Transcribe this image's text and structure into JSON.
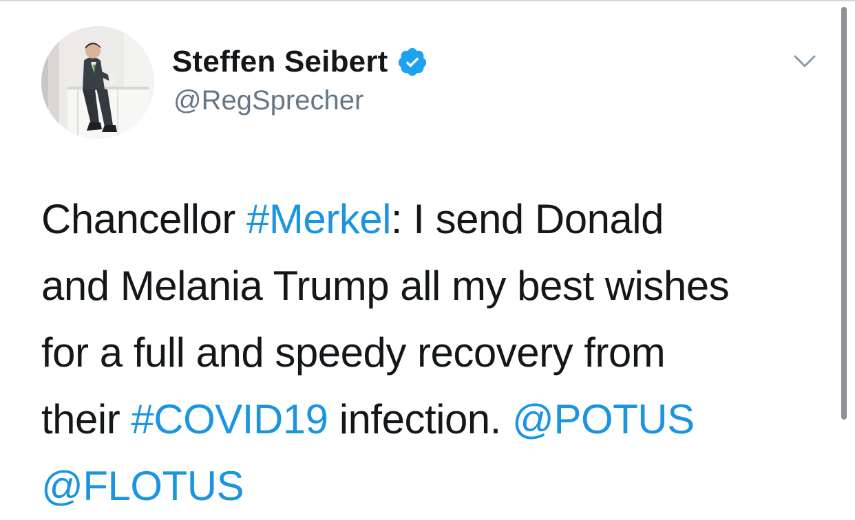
{
  "tweet": {
    "author": {
      "display_name": "Steffen Seibert",
      "handle": "@RegSprecher",
      "verified": true,
      "avatar_icon": "person-photo"
    },
    "more_icon": "chevron-down-icon",
    "text_lines": [
      [
        {
          "text": "Chancellor ",
          "type": "text"
        },
        {
          "text": "#Merkel",
          "type": "hashtag"
        },
        {
          "text": ": I send Donald",
          "type": "text"
        }
      ],
      [
        {
          "text": "and Melania Trump all my best wishes",
          "type": "text"
        }
      ],
      [
        {
          "text": "for a full and speedy recovery from",
          "type": "text"
        }
      ],
      [
        {
          "text": "their ",
          "type": "text"
        },
        {
          "text": "#COVID19",
          "type": "hashtag"
        },
        {
          "text": " infection. ",
          "type": "text"
        },
        {
          "text": "@POTUS",
          "type": "mention"
        }
      ],
      [
        {
          "text": "@FLOTUS",
          "type": "mention"
        }
      ]
    ]
  },
  "colors": {
    "link": "#1b95e0",
    "text": "#14171a",
    "handle": "#657786",
    "verified_badge": "#1da1f2"
  }
}
